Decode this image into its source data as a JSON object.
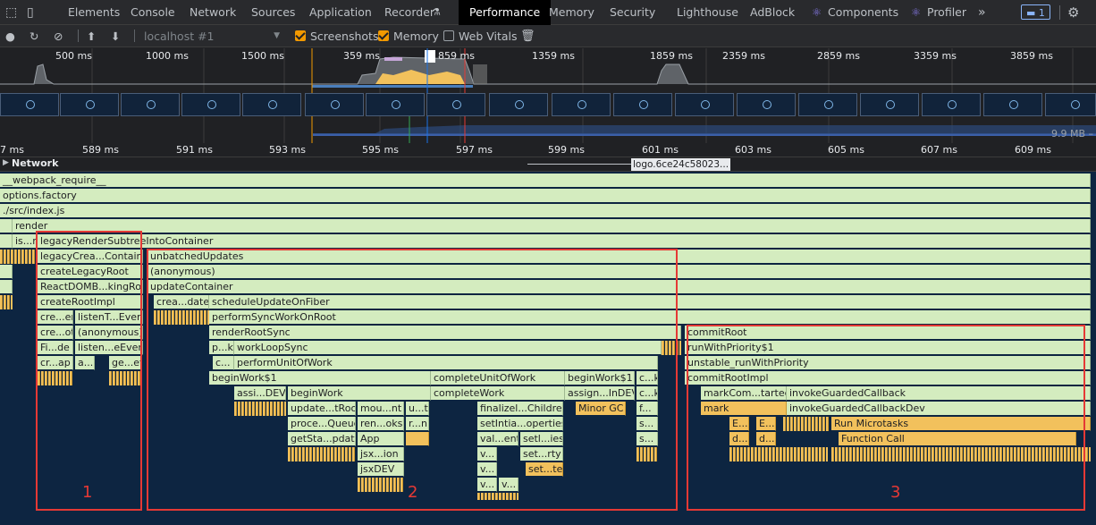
{
  "tabs": [
    "Elements",
    "Console",
    "Network",
    "Sources",
    "Application",
    "Recorder",
    "Performance",
    "Memory",
    "Security",
    "Lighthouse",
    "AdBlock",
    "Components",
    "Profiler"
  ],
  "active_tab": "Performance",
  "more_tabs": "»",
  "issues_badge": "1",
  "toolbar": {
    "target": "localhost #1",
    "screenshots_label": "Screenshots",
    "screenshots_checked": true,
    "memory_label": "Memory",
    "memory_checked": true,
    "webvitals_label": "Web Vitals",
    "webvitals_checked": false
  },
  "overview": {
    "ticks": [
      "500 ms",
      "1000 ms",
      "1500 ms",
      "359 ms",
      "859 ms",
      "1359 ms",
      "1859 ms",
      "2359 ms",
      "2859 ms",
      "3359 ms",
      "3859 ms"
    ],
    "memory_label": "9.9 MB –"
  },
  "ruler_ticks": [
    "7 ms",
    "589 ms",
    "591 ms",
    "593 ms",
    "595 ms",
    "597 ms",
    "599 ms",
    "601 ms",
    "603 ms",
    "605 ms",
    "607 ms",
    "609 ms"
  ],
  "network": {
    "label": "Network",
    "request_label": "logo.6ce24c58023..."
  },
  "flame": {
    "rows": [
      [
        "__webpack_require__"
      ],
      [
        "options.factory"
      ],
      [
        "./src/index.js"
      ],
      [
        "render"
      ],
      [
        "is...r",
        "legacyRenderSubtreeIntoContainer"
      ],
      [
        "legacyCrea...Container",
        "unbatchedUpdates"
      ],
      [
        "createLegacyRoot",
        "(anonymous)"
      ],
      [
        "ReactDOMB...kingRoot",
        "updateContainer"
      ],
      [
        "createRootImpl",
        "crea...date",
        "scheduleUpdateOnFiber"
      ],
      [
        "cre...er",
        "listenT...Events",
        "performSyncWorkOnRoot"
      ],
      [
        "cre...ot",
        "(anonymous)",
        "renderRootSync",
        "commitRoot"
      ],
      [
        "Fi...de",
        "listen...eEvent",
        "p...k",
        "workLoopSync",
        "runWithPriority$1"
      ],
      [
        "cr...ap",
        "a...",
        "ge...et",
        "c...",
        "performUnitOfWork",
        "unstable_runWithPriority"
      ],
      [
        "beginWork$1",
        "completeUnitOfWork",
        "beginWork$1",
        "c...k",
        "commitRootImpl"
      ],
      [
        "assi...DEV",
        "beginWork",
        "completeWork",
        "assign...InDEV",
        "c...k",
        "markCom...tarted",
        "invokeGuardedCallback"
      ],
      [
        "update...tRoot",
        "mou...nt",
        "u...t",
        "finalizel...Children",
        "Minor GC",
        "f...",
        "mark",
        "invokeGuardedCallbackDev"
      ],
      [
        "proce...Queue",
        "ren...oks",
        "r...n",
        "setIntia...operties",
        "s...",
        "E...",
        "E...",
        "Run Microtasks"
      ],
      [
        "getSta...pdate",
        "App",
        "val...ent",
        "setl...ies",
        "s...",
        "d...",
        "d...",
        "Function Call"
      ],
      [
        "jsx...ion",
        "v...",
        "set...rty"
      ],
      [
        "jsxDEV",
        "v...",
        "set...te"
      ],
      [
        "v...",
        "v..."
      ]
    ]
  },
  "boxes": [
    "1",
    "2",
    "3"
  ],
  "colors": {
    "flame_bg": "#0d2541",
    "frame": "#d4ecbf",
    "yellow_frame": "#f2c15c",
    "annotation": "#e53935",
    "accent": "#f29900"
  }
}
